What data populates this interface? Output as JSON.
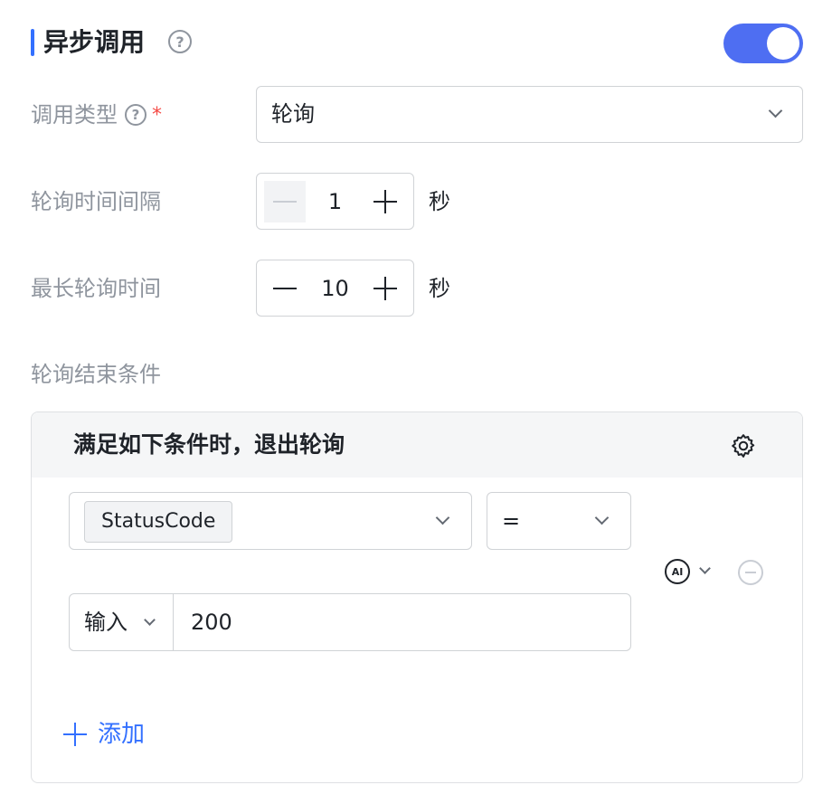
{
  "section": {
    "title": "异步调用",
    "help_icon": "question-circle-icon",
    "toggle_on": true
  },
  "form": {
    "call_type": {
      "label": "调用类型",
      "required_mark": "*",
      "value": "轮询"
    },
    "poll_interval": {
      "label": "轮询时间间隔",
      "value": "1",
      "unit": "秒"
    },
    "max_poll_time": {
      "label": "最长轮询时间",
      "value": "10",
      "unit": "秒"
    },
    "end_condition": {
      "label": "轮询结束条件"
    }
  },
  "condition_panel": {
    "title": "满足如下条件时，退出轮询",
    "settings_icon": "gear-icon",
    "rule": {
      "field": "StatusCode",
      "operator": "=",
      "value_type": "输入",
      "value": "200",
      "ai_label": "AI"
    },
    "add_label": "添加"
  },
  "colors": {
    "accent": "#3370ff",
    "toggle": "#4e6ef2",
    "required": "#f54a45",
    "muted_text": "#8f959e"
  }
}
